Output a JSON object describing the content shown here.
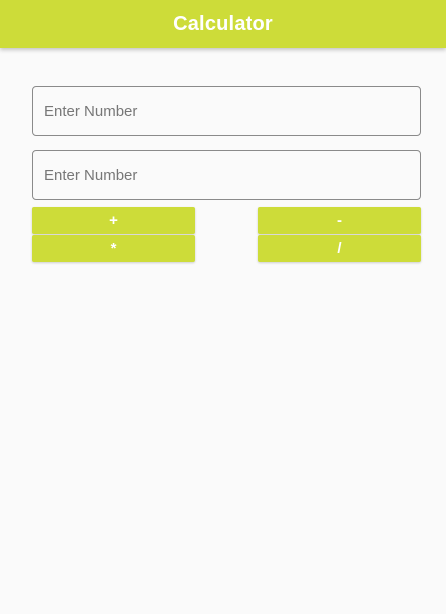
{
  "app_bar": {
    "title": "Calculator",
    "color": "#cddc39"
  },
  "inputs": [
    {
      "placeholder": "Enter Number",
      "value": ""
    },
    {
      "placeholder": "Enter Number",
      "value": ""
    }
  ],
  "buttons": {
    "add_label": "+",
    "subtract_label": "-",
    "multiply_label": "*",
    "divide_label": "/"
  },
  "colors": {
    "accent": "#cddc39",
    "background": "#fafafa",
    "button_text": "#ffffff"
  }
}
